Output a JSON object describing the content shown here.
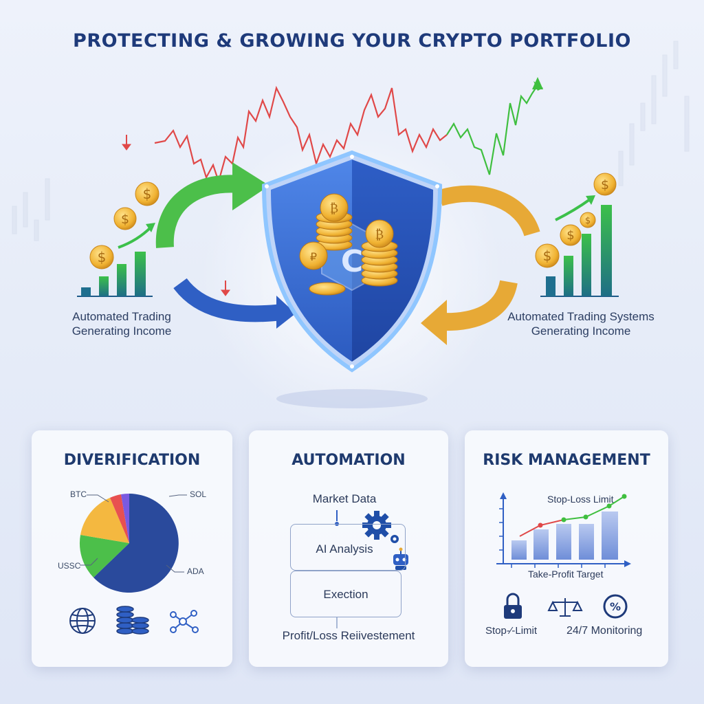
{
  "title": "PROTECTING & GROWING YOUR CRYPTO PORTFOLIO",
  "hero": {
    "left_caption_line1": "Automated Trading",
    "left_caption_line2": "Generating Income",
    "right_caption_line1": "Automated Trading Systems",
    "right_caption_line2": "Generating Income",
    "shield_icon": "shield-with-coins-icon",
    "colors": {
      "shield_blue": "#2f5fc4",
      "arrow_green": "#4cbf4a",
      "arrow_gold": "#e7a936",
      "price_red": "#e04848",
      "price_green": "#3fbf3f"
    }
  },
  "panels": {
    "diversification": {
      "title": "DIVERIFICATION",
      "labels": {
        "btc": "BTC",
        "sol": "SOL",
        "ussc": "USSC",
        "ada": "ADA"
      },
      "icons": [
        "globe-icon",
        "coin-stack-icon",
        "network-icon"
      ]
    },
    "automation": {
      "title": "AUTOMATION",
      "steps": [
        "Market Data",
        "AI Analysis",
        "Exection",
        "Profit/Loss Reiivestement"
      ],
      "icons": [
        "gear-icon",
        "robot-icon"
      ]
    },
    "risk": {
      "title": "RISK MANAGEMENT",
      "chart_label_top": "Stop-Loss Limit",
      "chart_label_bottom": "Take-Profit Target",
      "bottom_left": "Stop-⁄-Limit",
      "bottom_right": "24/7 Monitoring",
      "icons": [
        "lock-icon",
        "scales-icon",
        "percent-icon"
      ]
    }
  }
}
